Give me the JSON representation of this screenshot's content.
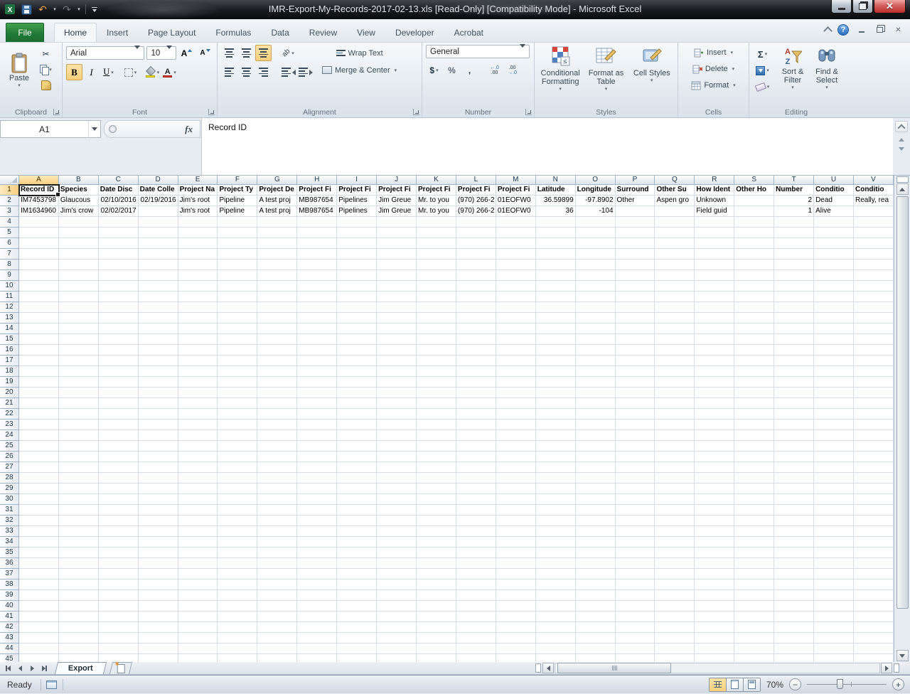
{
  "titlebar": {
    "title": "IMR-Export-My-Records-2017-02-13.xls  [Read-Only]  [Compatibility Mode]  -  Microsoft Excel"
  },
  "tabs": {
    "file": "File",
    "items": [
      "Home",
      "Insert",
      "Page Layout",
      "Formulas",
      "Data",
      "Review",
      "View",
      "Developer",
      "Acrobat"
    ],
    "active": "Home"
  },
  "ribbon": {
    "clipboard": {
      "group": "Clipboard",
      "paste": "Paste"
    },
    "font": {
      "group": "Font",
      "family": "Arial",
      "size": "10"
    },
    "alignment": {
      "group": "Alignment",
      "wrap": "Wrap Text",
      "merge": "Merge & Center"
    },
    "number": {
      "group": "Number",
      "format": "General"
    },
    "styles": {
      "group": "Styles",
      "conditional": "Conditional Formatting",
      "format_table": "Format as Table",
      "cell_styles": "Cell Styles"
    },
    "cells": {
      "group": "Cells",
      "insert": "Insert",
      "delete": "Delete",
      "format": "Format"
    },
    "editing": {
      "group": "Editing",
      "sort": "Sort & Filter",
      "find": "Find & Select"
    }
  },
  "glyphs": {
    "bold": "B",
    "italic": "I",
    "underline": "U",
    "grow_font": "A",
    "shrink_font": "A",
    "font_color": "A",
    "dollar": "$",
    "percent": "%",
    "comma": ",",
    "sigma": "Σ",
    "undo": "↶",
    "redo": "↷",
    "cut": "✂",
    "fx": "fx",
    "help": "?",
    "inc_dec_top": "←.0",
    "inc_dec_bot": ".00",
    "dec_dec_top": ".00",
    "dec_dec_bot": "→.0",
    "orientation": "ab",
    "minus": "−",
    "plus": "+",
    "close": "✕"
  },
  "formula_bar": {
    "name_box": "A1",
    "value": "Record ID"
  },
  "sheet": {
    "selected_cell": "A1",
    "columns": [
      "A",
      "B",
      "C",
      "D",
      "E",
      "F",
      "G",
      "H",
      "I",
      "J",
      "K",
      "L",
      "M",
      "N",
      "O",
      "P",
      "Q",
      "R",
      "S",
      "T",
      "U",
      "V"
    ],
    "header_row": [
      "Record ID",
      "Species",
      "Date Disc",
      "Date Colle",
      "Project Na",
      "Project Ty",
      "Project De",
      "Project Fi",
      "Project Fi",
      "Project Fi",
      "Project Fi",
      "Project Fi",
      "Project Fi",
      "Latitude",
      "Longitude",
      "Surround",
      "Other Su",
      "How Ident",
      "Other Ho",
      "Number",
      "Conditio",
      "Conditio"
    ],
    "rows": [
      [
        "IM7453798",
        "Glaucous",
        "02/10/2016",
        "02/19/2016",
        "Jim's root",
        "Pipeline",
        "A test proj",
        "MB987654",
        "Pipelines",
        "Jim Greue",
        "Mr. to you",
        "(970) 266-2",
        "01EOFW0",
        "36.59899",
        "-97.8902",
        "Other",
        "Aspen gro",
        "Unknown",
        "",
        "2",
        "Dead",
        "Really, rea"
      ],
      [
        "IM1634960",
        "Jim's crow",
        "02/02/2017",
        "",
        "Jim's root",
        "Pipeline",
        "A test proj",
        "MB987654",
        "Pipelines",
        "Jim Greue",
        "Mr. to you",
        "(970) 266-2",
        "01EOFW0",
        "36",
        "-104",
        "",
        "",
        "Field guid",
        "",
        "1",
        "Alive",
        ""
      ]
    ],
    "total_rows": 45
  },
  "sheet_tabs": {
    "active": "Export"
  },
  "status_bar": {
    "mode": "Ready",
    "zoom": "70%"
  }
}
